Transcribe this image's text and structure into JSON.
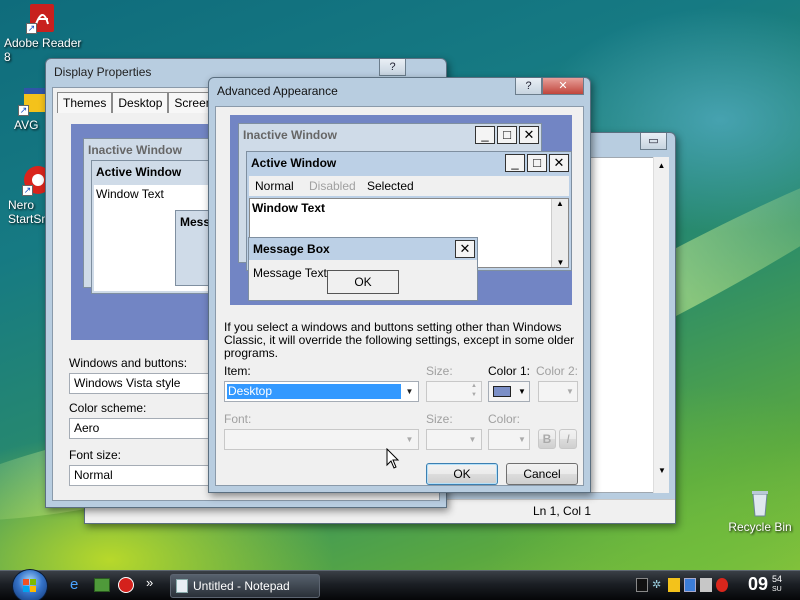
{
  "desktop": {
    "icons": [
      {
        "label": "Adobe Reader 8",
        "icon": "adobe-reader-icon"
      },
      {
        "label": "AVG",
        "icon": "avg-icon"
      },
      {
        "label": "Nero StartSmart",
        "icon": "nero-icon"
      },
      {
        "label": "Recycle Bin",
        "icon": "recycle-bin-icon"
      }
    ]
  },
  "notepad": {
    "status": "Ln 1, Col 1"
  },
  "display_properties": {
    "title": "Display Properties",
    "tabs": [
      "Themes",
      "Desktop",
      "Screen Sa"
    ],
    "preview": {
      "inactive_title": "Inactive Window",
      "active_title": "Active Window",
      "window_text": "Window Text",
      "message_title": "Messa"
    },
    "windows_buttons_label": "Windows and buttons:",
    "windows_buttons_value": "Windows Vista style",
    "color_scheme_label": "Color scheme:",
    "color_scheme_value": "Aero",
    "font_size_label": "Font size:",
    "font_size_value": "Normal"
  },
  "advanced": {
    "title": "Advanced Appearance",
    "help_icon": "?",
    "close_icon": "✕",
    "preview": {
      "inactive_title": "Inactive Window",
      "active_title": "Active Window",
      "menu_normal": "Normal",
      "menu_disabled": "Disabled",
      "menu_selected": "Selected",
      "window_text": "Window Text",
      "message_box_title": "Message Box",
      "message_text": "Message Text",
      "ok_label": "OK"
    },
    "info_text": "If you select a windows and buttons setting other than Windows Classic, it will override the following settings, except in some older programs.",
    "item_label": "Item:",
    "item_value": "Desktop",
    "size_label": "Size:",
    "color1_label": "Color 1:",
    "color1_value": "#7b8fc7",
    "color2_label": "Color 2:",
    "font_label": "Font:",
    "font_size_label": "Size:",
    "font_color_label": "Color:",
    "bold_label": "B",
    "italic_label": "I",
    "ok_button": "OK",
    "cancel_button": "Cancel"
  },
  "taskbar": {
    "task_label": "Untitled - Notepad",
    "clock_time": "09",
    "clock_minutes": "54",
    "clock_day": "SU",
    "quick_more": "»"
  },
  "colors": {
    "preview_bg": "#7285c4",
    "selection": "#3399ff",
    "taskbar": "#1b1f24"
  }
}
